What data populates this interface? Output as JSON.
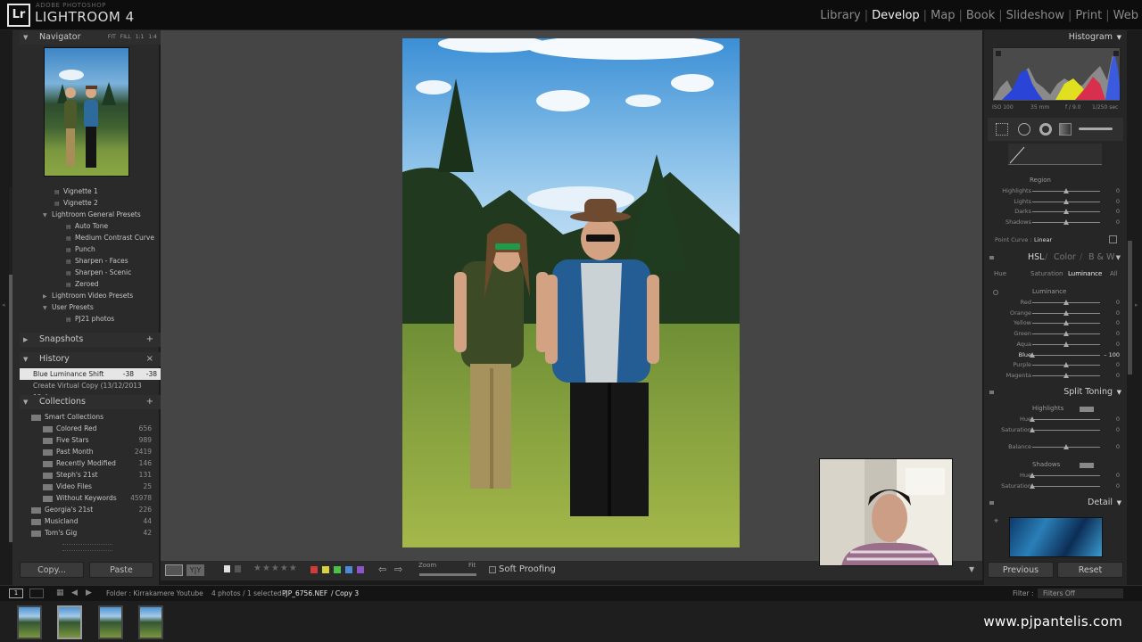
{
  "app": {
    "brand_mark": "Lr",
    "brand_sub": "ADOBE PHOTOSHOP",
    "title": "LIGHTROOM 4"
  },
  "modules": [
    {
      "label": "Library",
      "active": false
    },
    {
      "label": "Develop",
      "active": true
    },
    {
      "label": "Map",
      "active": false
    },
    {
      "label": "Book",
      "active": false
    },
    {
      "label": "Slideshow",
      "active": false
    },
    {
      "label": "Print",
      "active": false
    },
    {
      "label": "Web",
      "active": false
    }
  ],
  "navigator": {
    "title": "Navigator",
    "zoom_options": [
      "FIT",
      "FILL",
      "1:1",
      "1:4"
    ]
  },
  "presets": [
    {
      "label": "Vignette 1",
      "indent": 3,
      "icon": "preset"
    },
    {
      "label": "Vignette 2",
      "indent": 3,
      "icon": "preset"
    },
    {
      "label": "Lightroom General Presets",
      "indent": 2,
      "icon": "folder-open"
    },
    {
      "label": "Auto Tone",
      "indent": 4,
      "icon": "preset"
    },
    {
      "label": "Medium Contrast Curve",
      "indent": 4,
      "icon": "preset"
    },
    {
      "label": "Punch",
      "indent": 4,
      "icon": "preset"
    },
    {
      "label": "Sharpen - Faces",
      "indent": 4,
      "icon": "preset"
    },
    {
      "label": "Sharpen - Scenic",
      "indent": 4,
      "icon": "preset"
    },
    {
      "label": "Zeroed",
      "indent": 4,
      "icon": "preset"
    },
    {
      "label": "Lightroom Video Presets",
      "indent": 2,
      "icon": "folder-closed"
    },
    {
      "label": "User Presets",
      "indent": 2,
      "icon": "folder-open"
    },
    {
      "label": "PJ21 photos",
      "indent": 4,
      "icon": "preset"
    }
  ],
  "snapshots": {
    "title": "Snapshots",
    "action": "+"
  },
  "history": {
    "title": "History",
    "action": "×",
    "items": [
      {
        "label": "Blue Luminance Shift",
        "v1": "-38",
        "v2": "-38",
        "selected": true
      },
      {
        "label": "Create Virtual Copy (13/12/2013 12:4...",
        "v1": "",
        "v2": "",
        "selected": false
      }
    ]
  },
  "collections": {
    "title": "Collections",
    "action": "+",
    "items": [
      {
        "label": "Smart Collections",
        "count": "",
        "indent": 1
      },
      {
        "label": "Colored Red",
        "count": "656",
        "indent": 2
      },
      {
        "label": "Five Stars",
        "count": "989",
        "indent": 2
      },
      {
        "label": "Past Month",
        "count": "2419",
        "indent": 2
      },
      {
        "label": "Recently Modified",
        "count": "146",
        "indent": 2
      },
      {
        "label": "Steph's 21st",
        "count": "131",
        "indent": 2
      },
      {
        "label": "Video Files",
        "count": "25",
        "indent": 2
      },
      {
        "label": "Without Keywords",
        "count": "45978",
        "indent": 2
      },
      {
        "label": "Georgia's 21st",
        "count": "226",
        "indent": 1
      },
      {
        "label": "Musicland",
        "count": "44",
        "indent": 1
      },
      {
        "label": "Tom's Gig",
        "count": "42",
        "indent": 1
      }
    ]
  },
  "left_buttons": {
    "copy": "Copy...",
    "paste": "Paste"
  },
  "toolbar": {
    "zoom_label": "Zoom",
    "fit_label": "Fit",
    "soft_proofing": "Soft Proofing",
    "label_colors": [
      "#d23b3b",
      "#d8d23a",
      "#4cc14a",
      "#4a8ad8",
      "#8b55c9"
    ]
  },
  "right": {
    "histogram_title": "Histogram",
    "exif": {
      "iso": "ISO 100",
      "focal": "35 mm",
      "aperture": "f / 9.0",
      "shutter": "1/250 sec"
    },
    "region_title": "Region",
    "region": [
      {
        "label": "Highlights",
        "value": "0",
        "pos": 0.5
      },
      {
        "label": "Lights",
        "value": "0",
        "pos": 0.5
      },
      {
        "label": "Darks",
        "value": "0",
        "pos": 0.5
      },
      {
        "label": "Shadows",
        "value": "0",
        "pos": 0.5
      }
    ],
    "point_curve_label": "Point Curve :",
    "point_curve_value": "Linear",
    "hsl_title": [
      "HSL",
      "Color",
      "B & W"
    ],
    "hsl_tabs": [
      "Hue",
      "Saturation",
      "Luminance",
      "All"
    ],
    "hsl_active_tab": "Luminance",
    "luminance_title": "Luminance",
    "luminance": [
      {
        "label": "Red",
        "value": "0",
        "pos": 0.5
      },
      {
        "label": "Orange",
        "value": "0",
        "pos": 0.5
      },
      {
        "label": "Yellow",
        "value": "0",
        "pos": 0.5
      },
      {
        "label": "Green",
        "value": "0",
        "pos": 0.5
      },
      {
        "label": "Aqua",
        "value": "0",
        "pos": 0.5
      },
      {
        "label": "Blue",
        "value": "– 100",
        "pos": 0.0
      },
      {
        "label": "Purple",
        "value": "0",
        "pos": 0.5
      },
      {
        "label": "Magenta",
        "value": "0",
        "pos": 0.5
      }
    ],
    "split_toning_title": "Split Toning",
    "split_highlights_title": "Highlights",
    "split_highlights": [
      {
        "label": "Hue",
        "value": "0",
        "pos": 0.0
      },
      {
        "label": "Saturation",
        "value": "0",
        "pos": 0.0
      }
    ],
    "balance": {
      "label": "Balance",
      "value": "0",
      "pos": 0.5
    },
    "split_shadows_title": "Shadows",
    "split_shadows": [
      {
        "label": "Hue",
        "value": "0",
        "pos": 0.0
      },
      {
        "label": "Saturation",
        "value": "0",
        "pos": 0.0
      }
    ],
    "detail_title": "Detail",
    "previous": "Previous",
    "reset": "Reset"
  },
  "filmbar": {
    "folder": "Folder : Kirrakamere Youtube",
    "info": "4 photos / 1 selected /",
    "file": "PJP_6756.NEF",
    "copy": "/ Copy 3",
    "filter_label": "Filter :",
    "filter_value": "Filters Off"
  },
  "watermark": "www.pjpantelis.com"
}
